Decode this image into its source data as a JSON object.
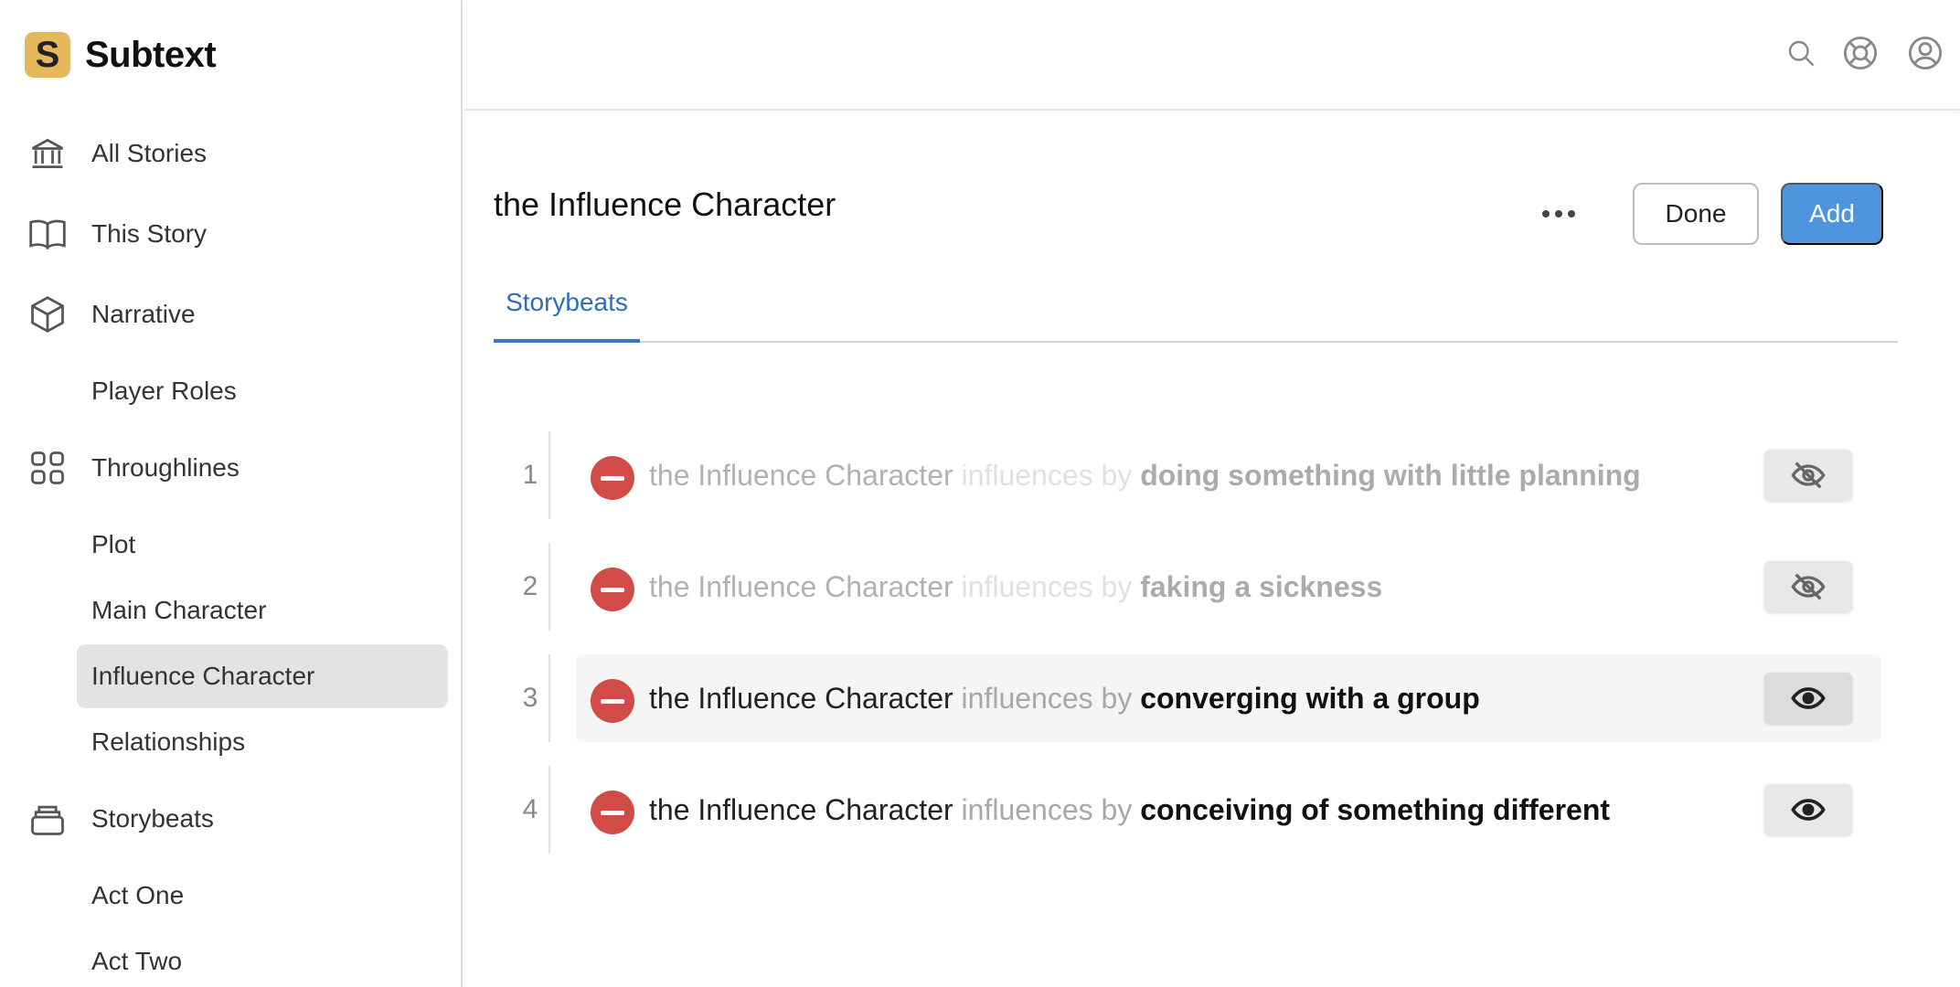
{
  "app": {
    "name": "Subtext",
    "logo_letter": "S",
    "logo_color": "#e6b85c"
  },
  "sidebar": {
    "items": [
      {
        "label": "All Stories",
        "icon": "bank-icon"
      },
      {
        "label": "This Story",
        "icon": "book-open-icon"
      },
      {
        "label": "Narrative",
        "icon": "cube-icon"
      },
      {
        "label": "Player Roles"
      },
      {
        "label": "Throughlines",
        "icon": "grid-four-icon"
      },
      {
        "label": "Plot"
      },
      {
        "label": "Main Character"
      },
      {
        "label": "Influence Character",
        "active": true
      },
      {
        "label": "Relationships"
      },
      {
        "label": "Storybeats",
        "icon": "stack-icon"
      },
      {
        "label": "Act One"
      },
      {
        "label": "Act Two"
      }
    ]
  },
  "topbar": {
    "icons": [
      "search-icon",
      "help-lifebuoy-icon",
      "user-account-icon"
    ]
  },
  "main": {
    "title": "the Influence Character",
    "done_label": "Done",
    "add_label": "Add",
    "add_color": "#4f95de",
    "tabs": [
      {
        "label": "Storybeats",
        "active": true
      }
    ],
    "beats": [
      {
        "number": "1",
        "subject": "the Influence Character",
        "verb": "influences by",
        "object": "doing something with little planning",
        "visible": false
      },
      {
        "number": "2",
        "subject": "the Influence Character",
        "verb": "influences by",
        "object": "faking a sickness",
        "visible": false
      },
      {
        "number": "3",
        "subject": "the Influence Character",
        "verb": "influences by",
        "object": "converging with a group",
        "visible": true
      },
      {
        "number": "4",
        "subject": "the Influence Character",
        "verb": "influences by",
        "object": "conceiving of something different",
        "visible": true
      }
    ]
  },
  "colors": {
    "remove": "#d14b47",
    "tab_active": "#2f6db8"
  }
}
